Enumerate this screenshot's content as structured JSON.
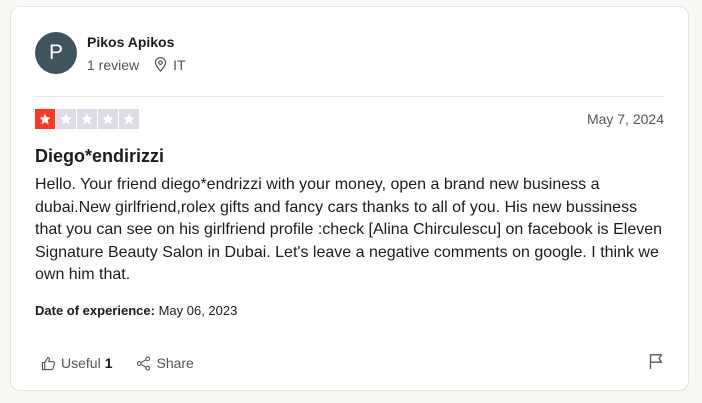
{
  "review": {
    "user": {
      "avatar_letter": "P",
      "name": "Pikos Apikos",
      "review_count": "1 review",
      "location": "IT"
    },
    "rating": 1,
    "rating_max": 5,
    "date": "May 7, 2024",
    "title": "Diego*endirizzi",
    "body": "Hello. Your friend diego*endrizzi with your money, open a brand new business a dubai.New girlfriend,rolex gifts and fancy cars thanks to all of you. His new bussiness that you can see on his girlfriend profile :check [Alina Chirculescu] on facebook is Eleven Signature Beauty Salon in Dubai. Let's leave a negative comments on google. I think we own him that.",
    "experience_label": "Date of experience:",
    "experience_date": "May 06, 2023"
  },
  "actions": {
    "useful_label": "Useful",
    "useful_count": "1",
    "share_label": "Share"
  },
  "colors": {
    "star_filled": "#ff3722",
    "star_empty": "#dcdce6",
    "avatar_bg": "#3e5560"
  },
  "icons": {
    "location": "location-pin-icon",
    "useful": "thumbs-up-icon",
    "share": "share-icon",
    "flag": "flag-icon"
  }
}
